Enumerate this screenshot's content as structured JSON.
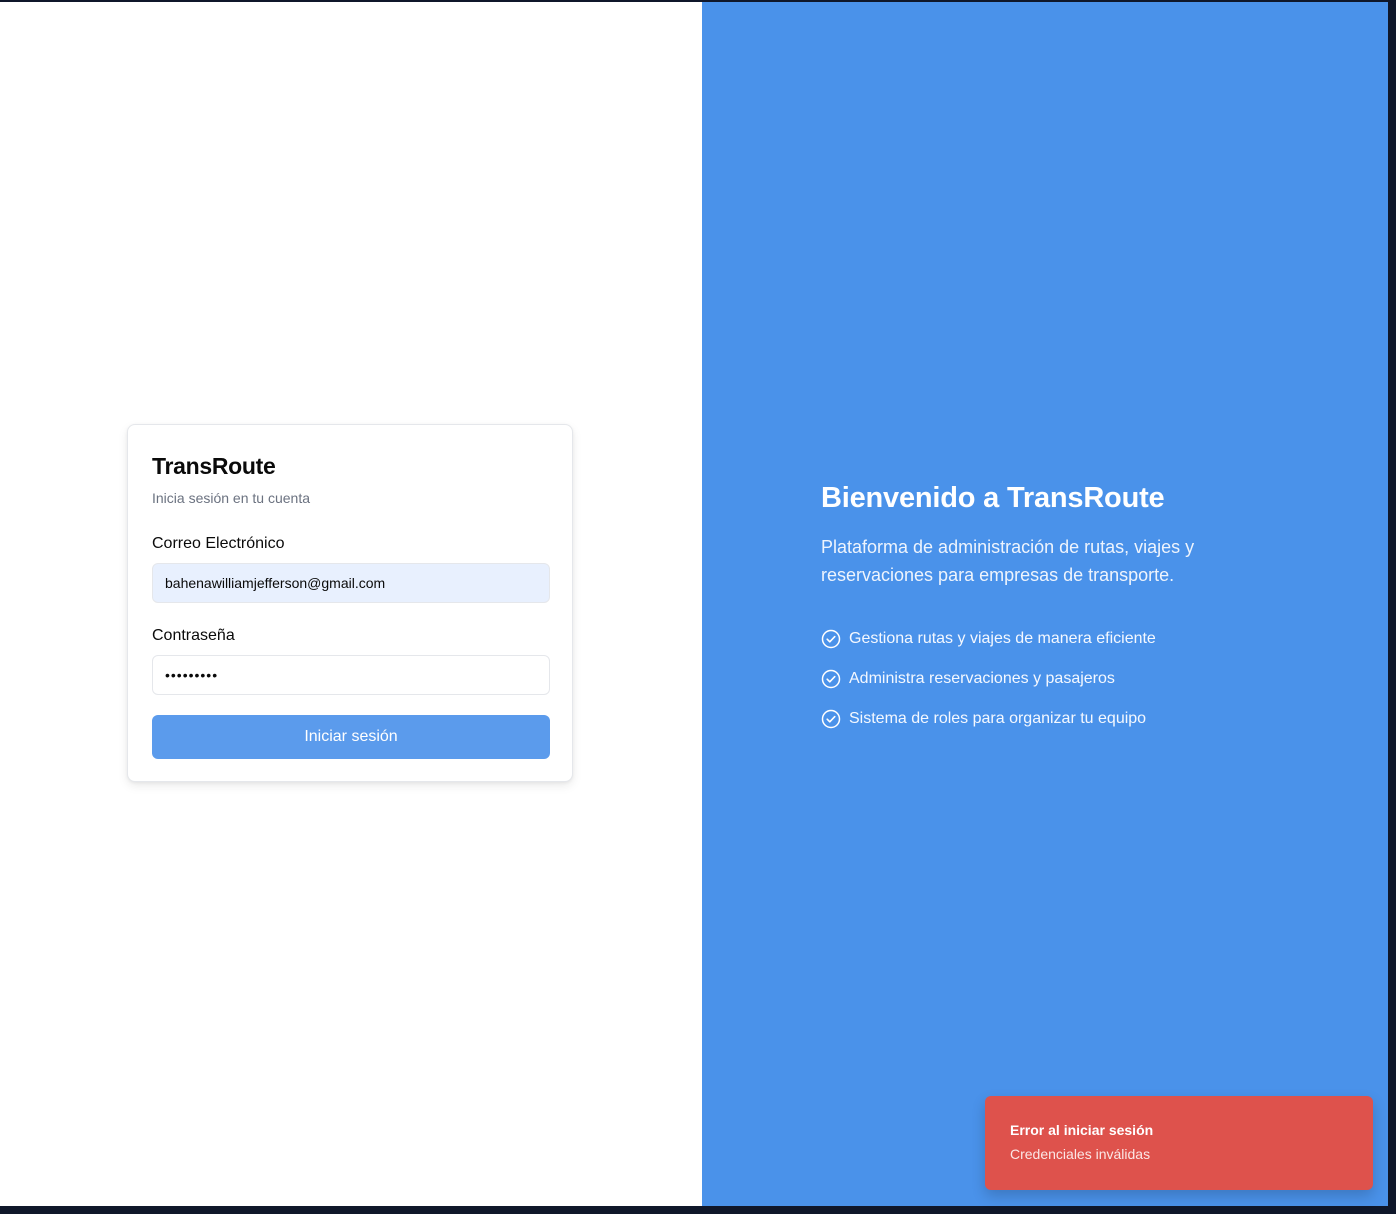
{
  "login_card": {
    "title": "TransRoute",
    "subtitle": "Inicia sesión en tu cuenta",
    "email_label": "Correo Electrónico",
    "email_value": "bahenawilliamjefferson@gmail.com",
    "password_label": "Contraseña",
    "password_value": "•••••••••",
    "submit_label": "Iniciar sesión"
  },
  "welcome": {
    "title": "Bienvenido a TransRoute",
    "description": "Plataforma de administración de rutas, viajes y reservaciones para empresas de transporte.",
    "features": [
      {
        "icon": "check-circle-icon",
        "label": "Gestiona rutas y viajes de manera eficiente"
      },
      {
        "icon": "check-circle-icon",
        "label": "Administra reservaciones y pasajeros"
      },
      {
        "icon": "check-circle-icon",
        "label": "Sistema de roles para organizar tu equipo"
      }
    ]
  },
  "toast": {
    "title": "Error al iniciar sesión",
    "description": "Credenciales inválidas"
  },
  "colors": {
    "brand_blue": "#4a92ea",
    "button_blue": "#5b9bec",
    "error_red": "#de524c",
    "autofill_bg": "#e8f0fe"
  }
}
